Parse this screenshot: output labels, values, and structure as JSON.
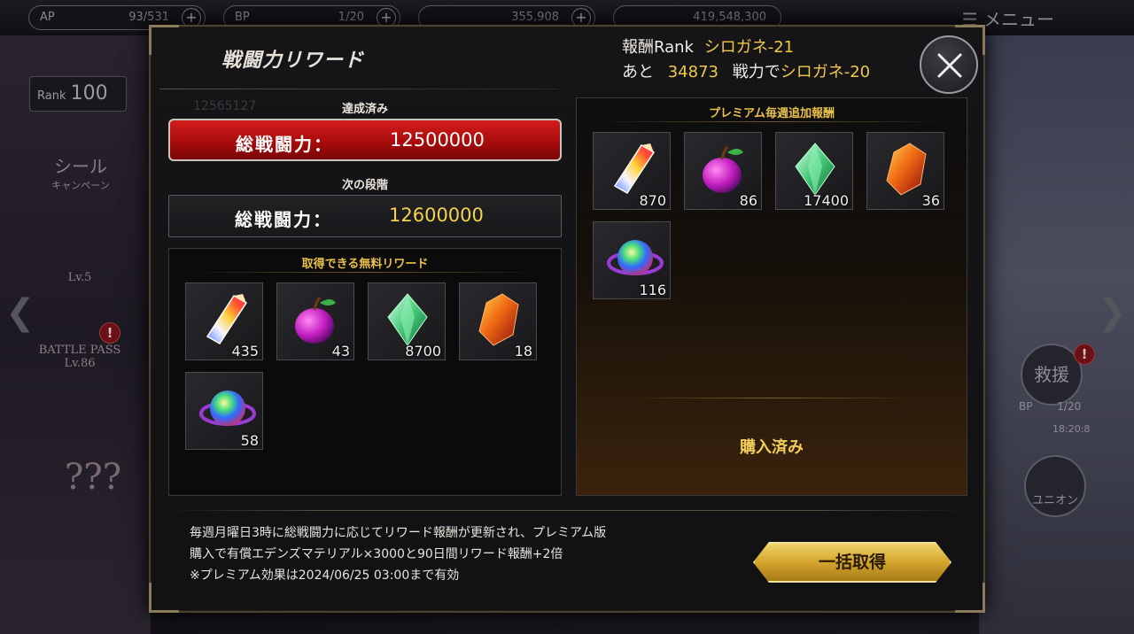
{
  "topbar": {
    "ap_label": "AP",
    "ap_value": "93/531",
    "bp_label": "BP",
    "bp_value": "1/20",
    "currency1": "355,908",
    "currency2": "419,548,300",
    "menu_label": "メニュー"
  },
  "sidebar": {
    "rank_label": "Rank",
    "rank_value": "100",
    "seal_campaign_line1": "シール",
    "seal_campaign_line2": "キャンペーン",
    "battle_pass": "BATTLE PASS",
    "battle_pass_level": "Lv.86",
    "greedy_pass_level": "Lv.5",
    "april_banner": "???"
  },
  "right_side": {
    "rescue_label": "救援",
    "bp_label": "BP",
    "bp_value": "1/20",
    "timer": "18:20:8",
    "union_label": "ユニオン"
  },
  "modal": {
    "title": "戦闘力リワード",
    "reward_rank_label": "報酬Rank",
    "reward_rank_value": "シロガネ-21",
    "remaining_prefix": "あと",
    "remaining_value": "34873",
    "remaining_mid": "戦力で",
    "remaining_target": "シロガネ-20",
    "achieved_label": "達成済み",
    "achieved_power_label": "総戦闘力：",
    "achieved_power_value": "12500000",
    "ghost_value": "12565127",
    "next_stage_label": "次の段階",
    "next_power_label": "総戦闘力：",
    "next_power_value": "12600000",
    "free_rewards_title": "取得できる無料リワード",
    "free_rewards": [
      {
        "icon": "rainbow-crystal-icon",
        "count": "435"
      },
      {
        "icon": "purple-apple-icon",
        "count": "43"
      },
      {
        "icon": "green-gem-icon",
        "count": "8700"
      },
      {
        "icon": "red-crystal-icon",
        "count": "18"
      },
      {
        "icon": "rainbow-orb-icon",
        "count": "58"
      }
    ],
    "premium_rewards_title": "プレミアム毎週追加報酬",
    "premium_rewards": [
      {
        "icon": "rainbow-crystal-icon",
        "count": "870"
      },
      {
        "icon": "purple-apple-icon",
        "count": "86"
      },
      {
        "icon": "green-gem-icon",
        "count": "17400"
      },
      {
        "icon": "red-crystal-icon",
        "count": "36"
      },
      {
        "icon": "rainbow-orb-icon",
        "count": "116"
      }
    ],
    "purchased_label": "購入済み",
    "description_line1": "毎週月曜日3時に総戦闘力に応じてリワード報酬が更新され、プレミアム版",
    "description_line2": "購入で有償エデンズマテリアル×3000と90日間リワード報酬+2倍",
    "description_line3": "※プレミアム効果は2024/06/25 03:00まで有効",
    "claim_all_label": "一括取得"
  },
  "colors": {
    "gold": "#f1c84a",
    "achieved_red": "#c41616",
    "panel_border": "#4a4235"
  }
}
